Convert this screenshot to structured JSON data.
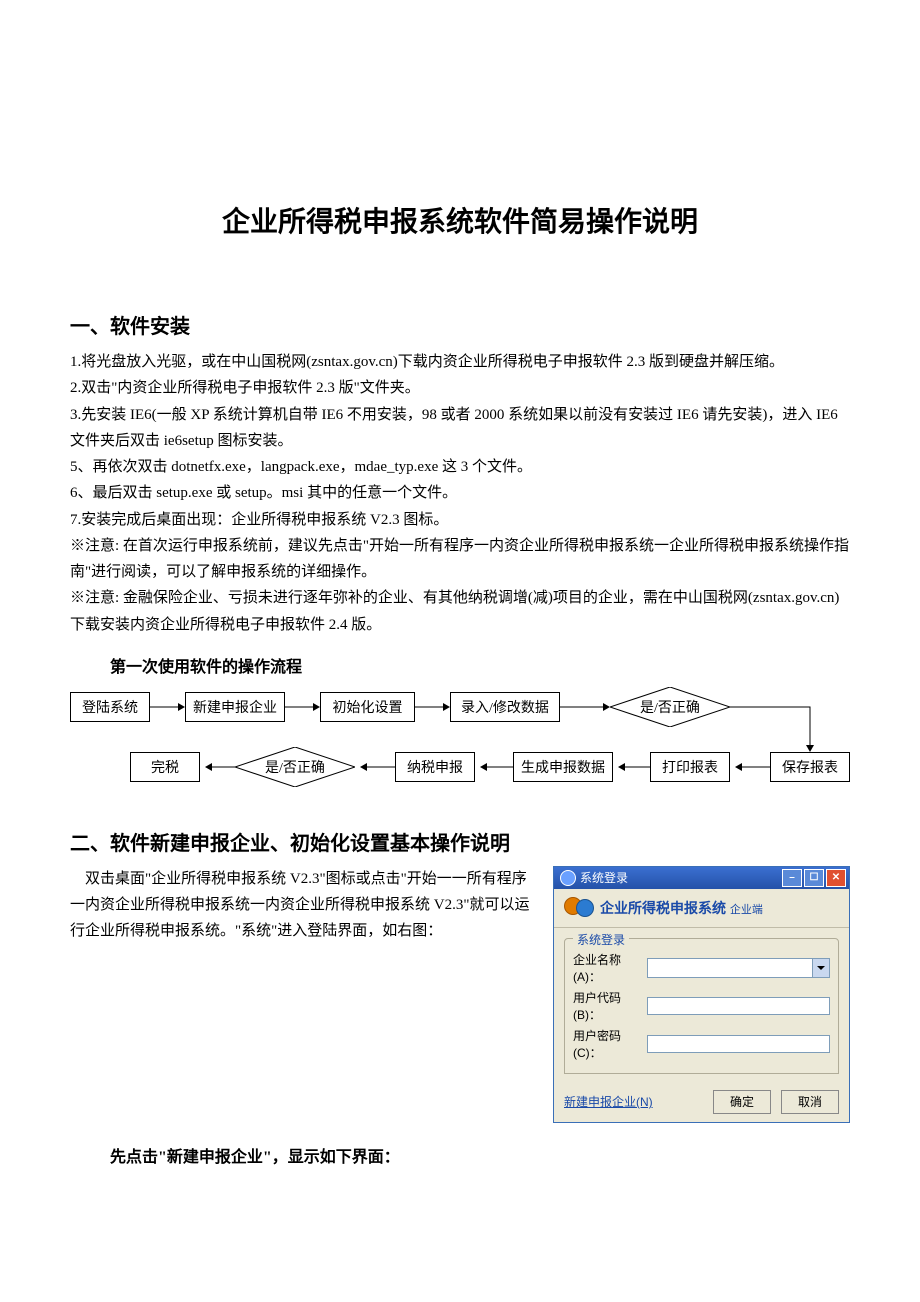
{
  "title": "企业所得税申报系统软件简易操作说明",
  "section1": {
    "heading": "一、软件安装",
    "p1": "1.将光盘放入光驱，或在中山国税网(zsntax.gov.cn)下载内资企业所得税电子申报软件 2.3 版到硬盘并解压缩。",
    "p2": "2.双击\"内资企业所得税电子申报软件 2.3 版\"文件夹。",
    "p3": "3.先安装 IE6(一般 XP 系统计算机自带 IE6 不用安装，98 或者 2000 系统如果以前没有安装过 IE6 请先安装)，进入 IE6 文件夹后双击 ie6setup 图标安装。",
    "p5": "5、再依次双击 dotnetfx.exe，langpack.exe，mdae_typ.exe 这 3 个文件。",
    "p6": "6、最后双击 setup.exe 或 setup。msi 其中的任意一个文件。",
    "p7": "7.安装完成后桌面出现：企业所得税申报系统 V2.3 图标。",
    "note1": "※注意: 在首次运行申报系统前，建议先点击\"开始一所有程序一内资企业所得税申报系统一企业所得税申报系统操作指南\"进行阅读，可以了解申报系统的详细操作。",
    "note2": "※注意: 金融保险企业、亏损未进行逐年弥补的企业、有其他纳税调增(减)项目的企业，需在中山国税网(zsntax.gov.cn)下载安装内资企业所得税电子申报软件 2.4 版。"
  },
  "flowchart": {
    "subheading": "第一次使用软件的操作流程",
    "login": "登陆系统",
    "new": "新建申报企业",
    "init": "初始化设置",
    "input": "录入/修改数据",
    "check1": "是/否正确",
    "save": "保存报表",
    "print": "打印报表",
    "gen": "生成申报数据",
    "report": "纳税申报",
    "check2": "是/否正确",
    "done": "完税"
  },
  "section2": {
    "heading": "二、软件新建申报企业、初始化设置基本操作说明",
    "para": "    双击桌面\"企业所得税申报系统 V2.3\"图标或点击\"开始一一所有程序一内资企业所得税申报系统一内资企业所得税申报系统 V2.3\"就可以运行企业所得税申报系统。\"系统\"进入登陆界面，如右图：",
    "closing": "先点击\"新建申报企业\"，显示如下界面："
  },
  "login": {
    "titlebar": "系统登录",
    "header_main": "企业所得税申报系统",
    "header_sub": "企业端",
    "group": "系统登录",
    "label_company": "企业名称(A)：",
    "label_userid": "用户代码(B)：",
    "label_password": "用户密码(C)：",
    "link_new": "新建申报企业(N)",
    "btn_ok": "确定",
    "btn_cancel": "取消"
  }
}
